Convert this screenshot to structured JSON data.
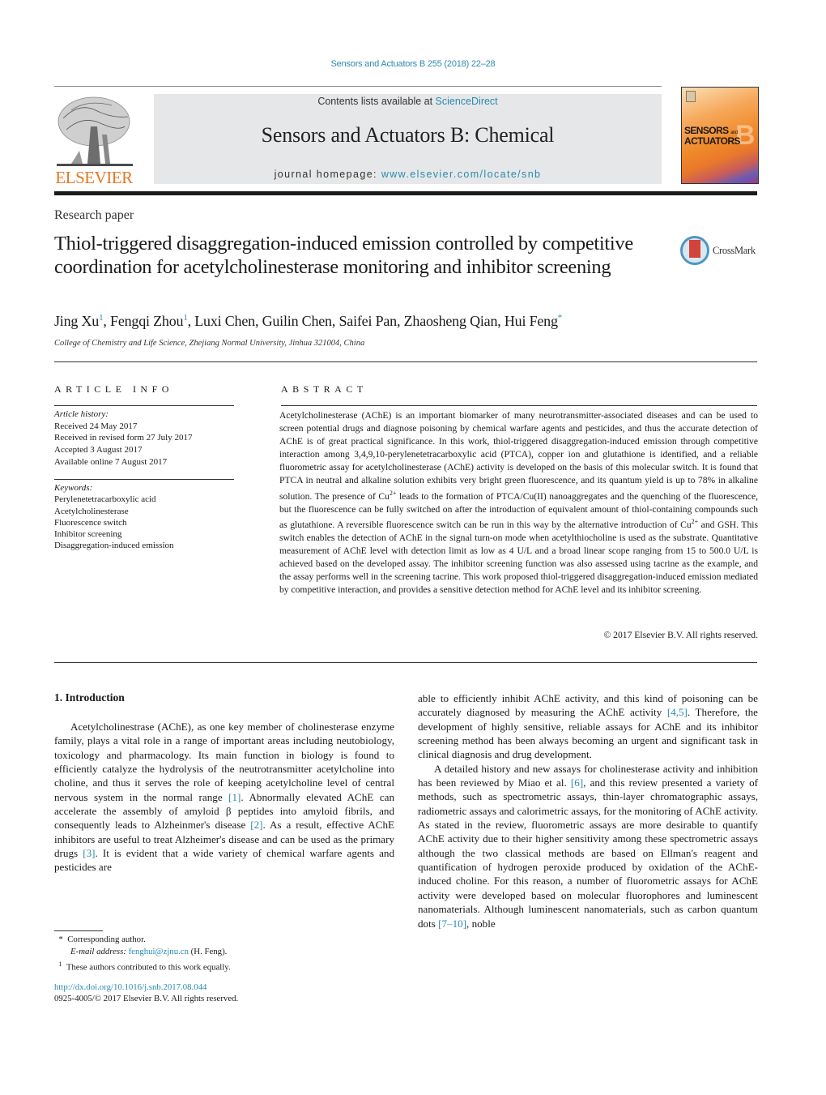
{
  "header": {
    "citation": "Sensors and Actuators B 255 (2018) 22–28",
    "contents_prefix": "Contents lists available at ",
    "contents_link": "ScienceDirect",
    "journal_name": "Sensors and Actuators B: Chemical",
    "homepage_prefix": "journal homepage: ",
    "homepage_link": "www.elsevier.com/locate/snb",
    "publisher_logo_text": "ELSEVIER",
    "cover": {
      "title_line1": "SENSORS",
      "title_and": "and",
      "title_line2": "ACTUATORS",
      "letter": "B"
    },
    "colors": {
      "link": "#2a8ab0",
      "elsevier_orange": "#e87722",
      "masthead_bg": "#e6e7e8"
    }
  },
  "article": {
    "type": "Research paper",
    "title": "Thiol-triggered disaggregation-induced emission controlled by competitive coordination for acetylcholinesterase monitoring and inhibitor screening",
    "crossmark_label": "CrossMark",
    "authors": [
      {
        "name": "Jing Xu",
        "mark": "1"
      },
      {
        "name": "Fengqi Zhou",
        "mark": "1"
      },
      {
        "name": "Luxi Chen",
        "mark": ""
      },
      {
        "name": "Guilin Chen",
        "mark": ""
      },
      {
        "name": "Saifei Pan",
        "mark": ""
      },
      {
        "name": "Zhaosheng Qian",
        "mark": ""
      },
      {
        "name": "Hui Feng",
        "mark": "*"
      }
    ],
    "affiliation": "College of Chemistry and Life Science, Zhejiang Normal University, Jinhua 321004, China"
  },
  "article_info": {
    "heading": "ARTICLE INFO",
    "history_label": "Article history:",
    "history": [
      "Received 24 May 2017",
      "Received in revised form 27 July 2017",
      "Accepted 3 August 2017",
      "Available online 7 August 2017"
    ],
    "keywords_label": "Keywords:",
    "keywords": [
      "Perylenetetracarboxylic acid",
      "Acetylcholinesterase",
      "Fluorescence switch",
      "Inhibitor screening",
      "Disaggregation-induced emission"
    ]
  },
  "abstract": {
    "heading": "ABSTRACT",
    "text_part1": "Acetylcholinesterase (AChE) is an important biomarker of many neurotransmitter-associated diseases and can be used to screen potential drugs and diagnose poisoning by chemical warfare agents and pesticides, and thus the accurate detection of AChE is of great practical significance. In this work, thiol-triggered disaggregation-induced emission through competitive interaction among 3,4,9,10-perylenetetracarboxylic acid (PTCA), copper ion and glutathione is identified, and a reliable fluorometric assay for acetylcholinesterase (AChE) activity is developed on the basis of this molecular switch. It is found that PTCA in neutral and alkaline solution exhibits very bright green fluorescence, and its quantum yield is up to 78% in alkaline solution. The presence of Cu",
    "sup1": "2+",
    "text_part2": " leads to the formation of PTCA/Cu(II) nanoaggregates and the quenching of the fluorescence, but the fluorescence can be fully switched on after the introduction of equivalent amount of thiol-containing compounds such as glutathione. A reversible fluorescence switch can be run in this way by the alternative introduction of Cu",
    "sup2": "2+",
    "text_part3": " and GSH. This switch enables the detection of AChE in the signal turn-on mode when acetylthiocholine is used as the substrate. Quantitative measurement of AChE level with detection limit as low as 4 U/L and a broad linear scope ranging from 15 to 500.0 U/L is achieved based on the developed assay. The inhibitor screening function was also assessed using tacrine as the example, and the assay performs well in the screening tacrine. This work proposed thiol-triggered disaggregation-induced emission mediated by competitive interaction, and provides a sensitive detection method for AChE level and its inhibitor screening.",
    "copyright": "© 2017 Elsevier B.V. All rights reserved."
  },
  "body": {
    "section_heading": "1.  Introduction",
    "left_p1_a": "Acetylcholinestrase (AChE), as one key member of cholinesterase enzyme family, plays a vital role in a range of important areas including neutobiology, toxicology and pharmacology. Its main function in biology is found to efficiently catalyze the hydrolysis of the neutrotransmitter acetylcholine into choline, and thus it serves the role of keeping acetylcholine level of central nervous system in the normal range ",
    "ref1": "[1]",
    "left_p1_b": ". Abnormally elevated AChE can accelerate the assembly of amyloid β peptides into amyloid fibrils, and consequently leads to Alzheinmer's disease ",
    "ref2": "[2]",
    "left_p1_c": ". As a result, effective AChE inhibitors are useful to treat Alzheimer's disease and can be used as the primary drugs ",
    "ref3": "[3]",
    "left_p1_d": ". It is evident that a wide variety of chemical warfare agents and pesticides are",
    "right_p1_a": "able to efficiently inhibit AChE activity, and this kind of poisoning can be accurately diagnosed by measuring the AChE activity ",
    "ref45": "[4,5]",
    "right_p1_b": ". Therefore, the development of highly sensitive, reliable assays for AChE and its inhibitor screening method has been always becoming an urgent and significant task in clinical diagnosis and drug development.",
    "right_p2_a": "A detailed history and new assays for cholinesterase activity and inhibition has been reviewed by Miao et al. ",
    "ref6": "[6]",
    "right_p2_b": ", and this review presented a variety of methods, such as spectrometric assays, thin-layer chromatographic assays, radiometric assays and calorimetric assays, for the monitoring of AChE activity. As stated in the review, fluorometric assays are more desirable to quantify AChE activity due to their higher sensitivity among these spectrometric assays although the two classical methods are based on Ellman's reagent and quantification of hydrogen peroxide produced by oxidation of the AChE-induced choline. For this reason, a number of fluorometric assays for AChE activity were developed based on molecular fluorophores and luminescent nanomaterials. Although luminescent nanomaterials, such as carbon quantum dots ",
    "ref710": "[7–10]",
    "right_p2_c": ", noble"
  },
  "footnotes": {
    "corresponding_mark": "*",
    "corresponding": "Corresponding author.",
    "email_label": "E-mail address: ",
    "email": "fenghui@zjnu.cn",
    "email_suffix": " (H. Feng).",
    "equal_mark": "1",
    "equal": "These authors contributed to this work equally.",
    "doi": "http://dx.doi.org/10.1016/j.snb.2017.08.044",
    "issn": "0925-4005/© 2017 Elsevier B.V. All rights reserved."
  }
}
